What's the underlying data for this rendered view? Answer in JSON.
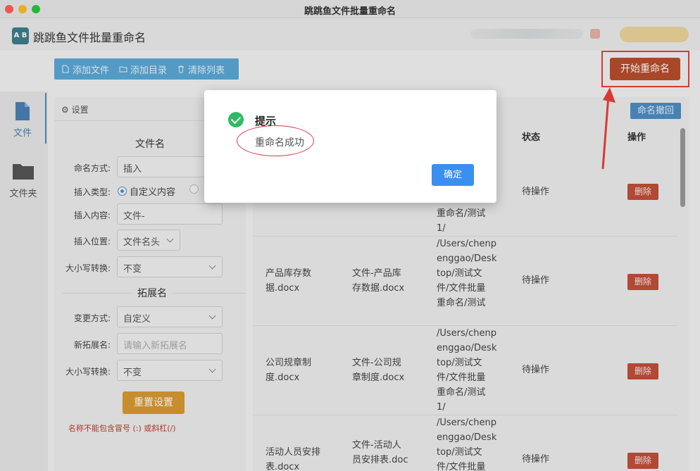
{
  "window": {
    "title": "跳跳鱼文件批量重命名"
  },
  "app": {
    "name": "跳跳鱼文件批量重命名",
    "logo_text": "A B"
  },
  "toolbar": {
    "add_file": "添加文件",
    "add_dir": "添加目录",
    "clear_list": "清除列表",
    "start_rename": "开始重命名"
  },
  "nav": {
    "file": "文件",
    "folder": "文件夹"
  },
  "settings": {
    "header": "设置",
    "filename_section": "文件名",
    "naming_method_label": "命名方式:",
    "naming_method_value": "插入",
    "insert_type_label": "插入类型:",
    "insert_type_option1": "自定义内容",
    "insert_content_label": "插入内容:",
    "insert_content_value": "文件-",
    "insert_position_label": "插入位置:",
    "insert_position_value": "文件名头",
    "case_label": "大小写转换:",
    "case_value": "不变",
    "ext_section": "拓展名",
    "change_method_label": "变更方式:",
    "change_method_value": "自定义",
    "new_ext_label": "新拓展名:",
    "new_ext_placeholder": "请输入新拓展名",
    "ext_case_label": "大小写转换:",
    "ext_case_value": "不变",
    "reset_button": "重置设置",
    "warning": "名称不能包含冒号 (:) 或斜杠(/)"
  },
  "table": {
    "undo_button": "命名撤回",
    "col_status": "状态",
    "col_action": "操作",
    "rows": [
      {
        "orig": [
          "",
          ""
        ],
        "new": [
          "",
          ""
        ],
        "path": [
          "重命名/测试",
          "1/"
        ],
        "status": "待操作",
        "action": "删除"
      },
      {
        "orig": [
          "产品库存数",
          "据.docx"
        ],
        "new": [
          "文件-产品库",
          "存数据.docx"
        ],
        "path": [
          "/Users/chenp",
          "enggao/Desk",
          "top/测试文",
          "件/文件批量",
          "重命名/测试"
        ],
        "status": "待操作",
        "action": "删除"
      },
      {
        "orig": [
          "公司规章制",
          "度.docx"
        ],
        "new": [
          "文件-公司规",
          "章制度.docx"
        ],
        "path": [
          "/Users/chenp",
          "enggao/Desk",
          "top/测试文",
          "件/文件批量",
          "重命名/测试",
          "1/"
        ],
        "status": "待操作",
        "action": "删除"
      },
      {
        "orig": [
          "活动人员安排",
          "表.docx"
        ],
        "new": [
          "文件-活动人",
          "员安排表.doc"
        ],
        "path": [
          "/Users/chenp",
          "enggao/Desk",
          "top/测试文",
          "件/文件批量"
        ],
        "status": "待操作",
        "action": "删除"
      }
    ]
  },
  "dialog": {
    "title": "提示",
    "message": "重命名成功",
    "ok_button": "确定"
  },
  "colors": {
    "toolbar_blue": "#5ba9d6",
    "start_button": "#b84f2c",
    "delete_button": "#c0503a",
    "reset_button": "#d99a30",
    "ok_button": "#3b8ff0",
    "success_green": "#2fbb63",
    "highlight_red": "#e8403a"
  }
}
